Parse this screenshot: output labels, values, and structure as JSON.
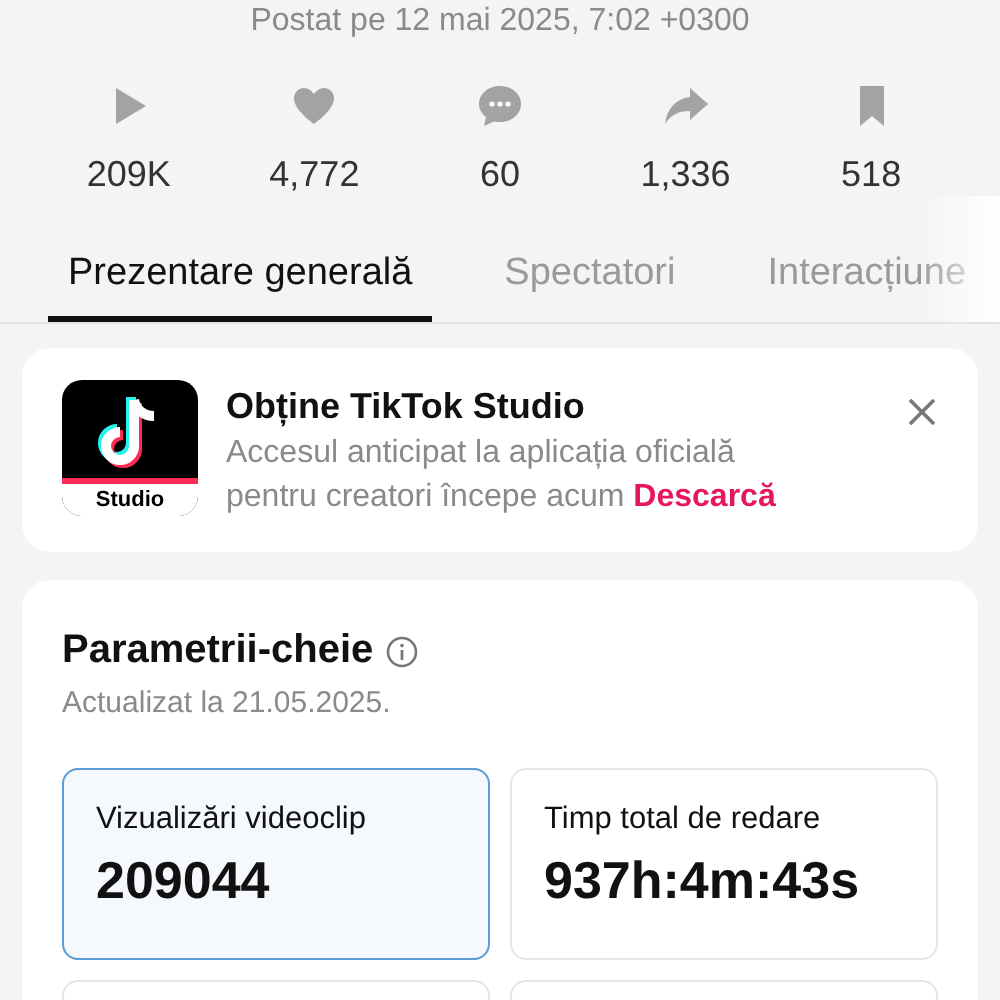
{
  "posted": "Postat pe 12 mai 2025, 7:02 +0300",
  "stats": [
    {
      "kind": "play",
      "count": "209K"
    },
    {
      "kind": "heart",
      "count": "4,772"
    },
    {
      "kind": "comment",
      "count": "60"
    },
    {
      "kind": "share",
      "count": "1,336"
    },
    {
      "kind": "bookmark",
      "count": "518"
    }
  ],
  "tabs": [
    {
      "label": "Prezentare generală",
      "selected": true
    },
    {
      "label": "Spectatori",
      "selected": false
    },
    {
      "label": "Interacțiune",
      "selected": false
    }
  ],
  "promo": {
    "app_label": "Studio",
    "title": "Obține TikTok Studio",
    "text": "Accesul anticipat la aplicația oficială pentru creatori începe acum",
    "link": "Descarcă"
  },
  "metrics": {
    "title": "Parametrii-cheie",
    "updated": "Actualizat la 21.05.2025.",
    "tiles": [
      {
        "label": "Vizualizări videoclip",
        "value": "209044",
        "selected": true
      },
      {
        "label": "Timp total de redare",
        "value": "937h:4m:43s",
        "selected": false
      }
    ]
  }
}
